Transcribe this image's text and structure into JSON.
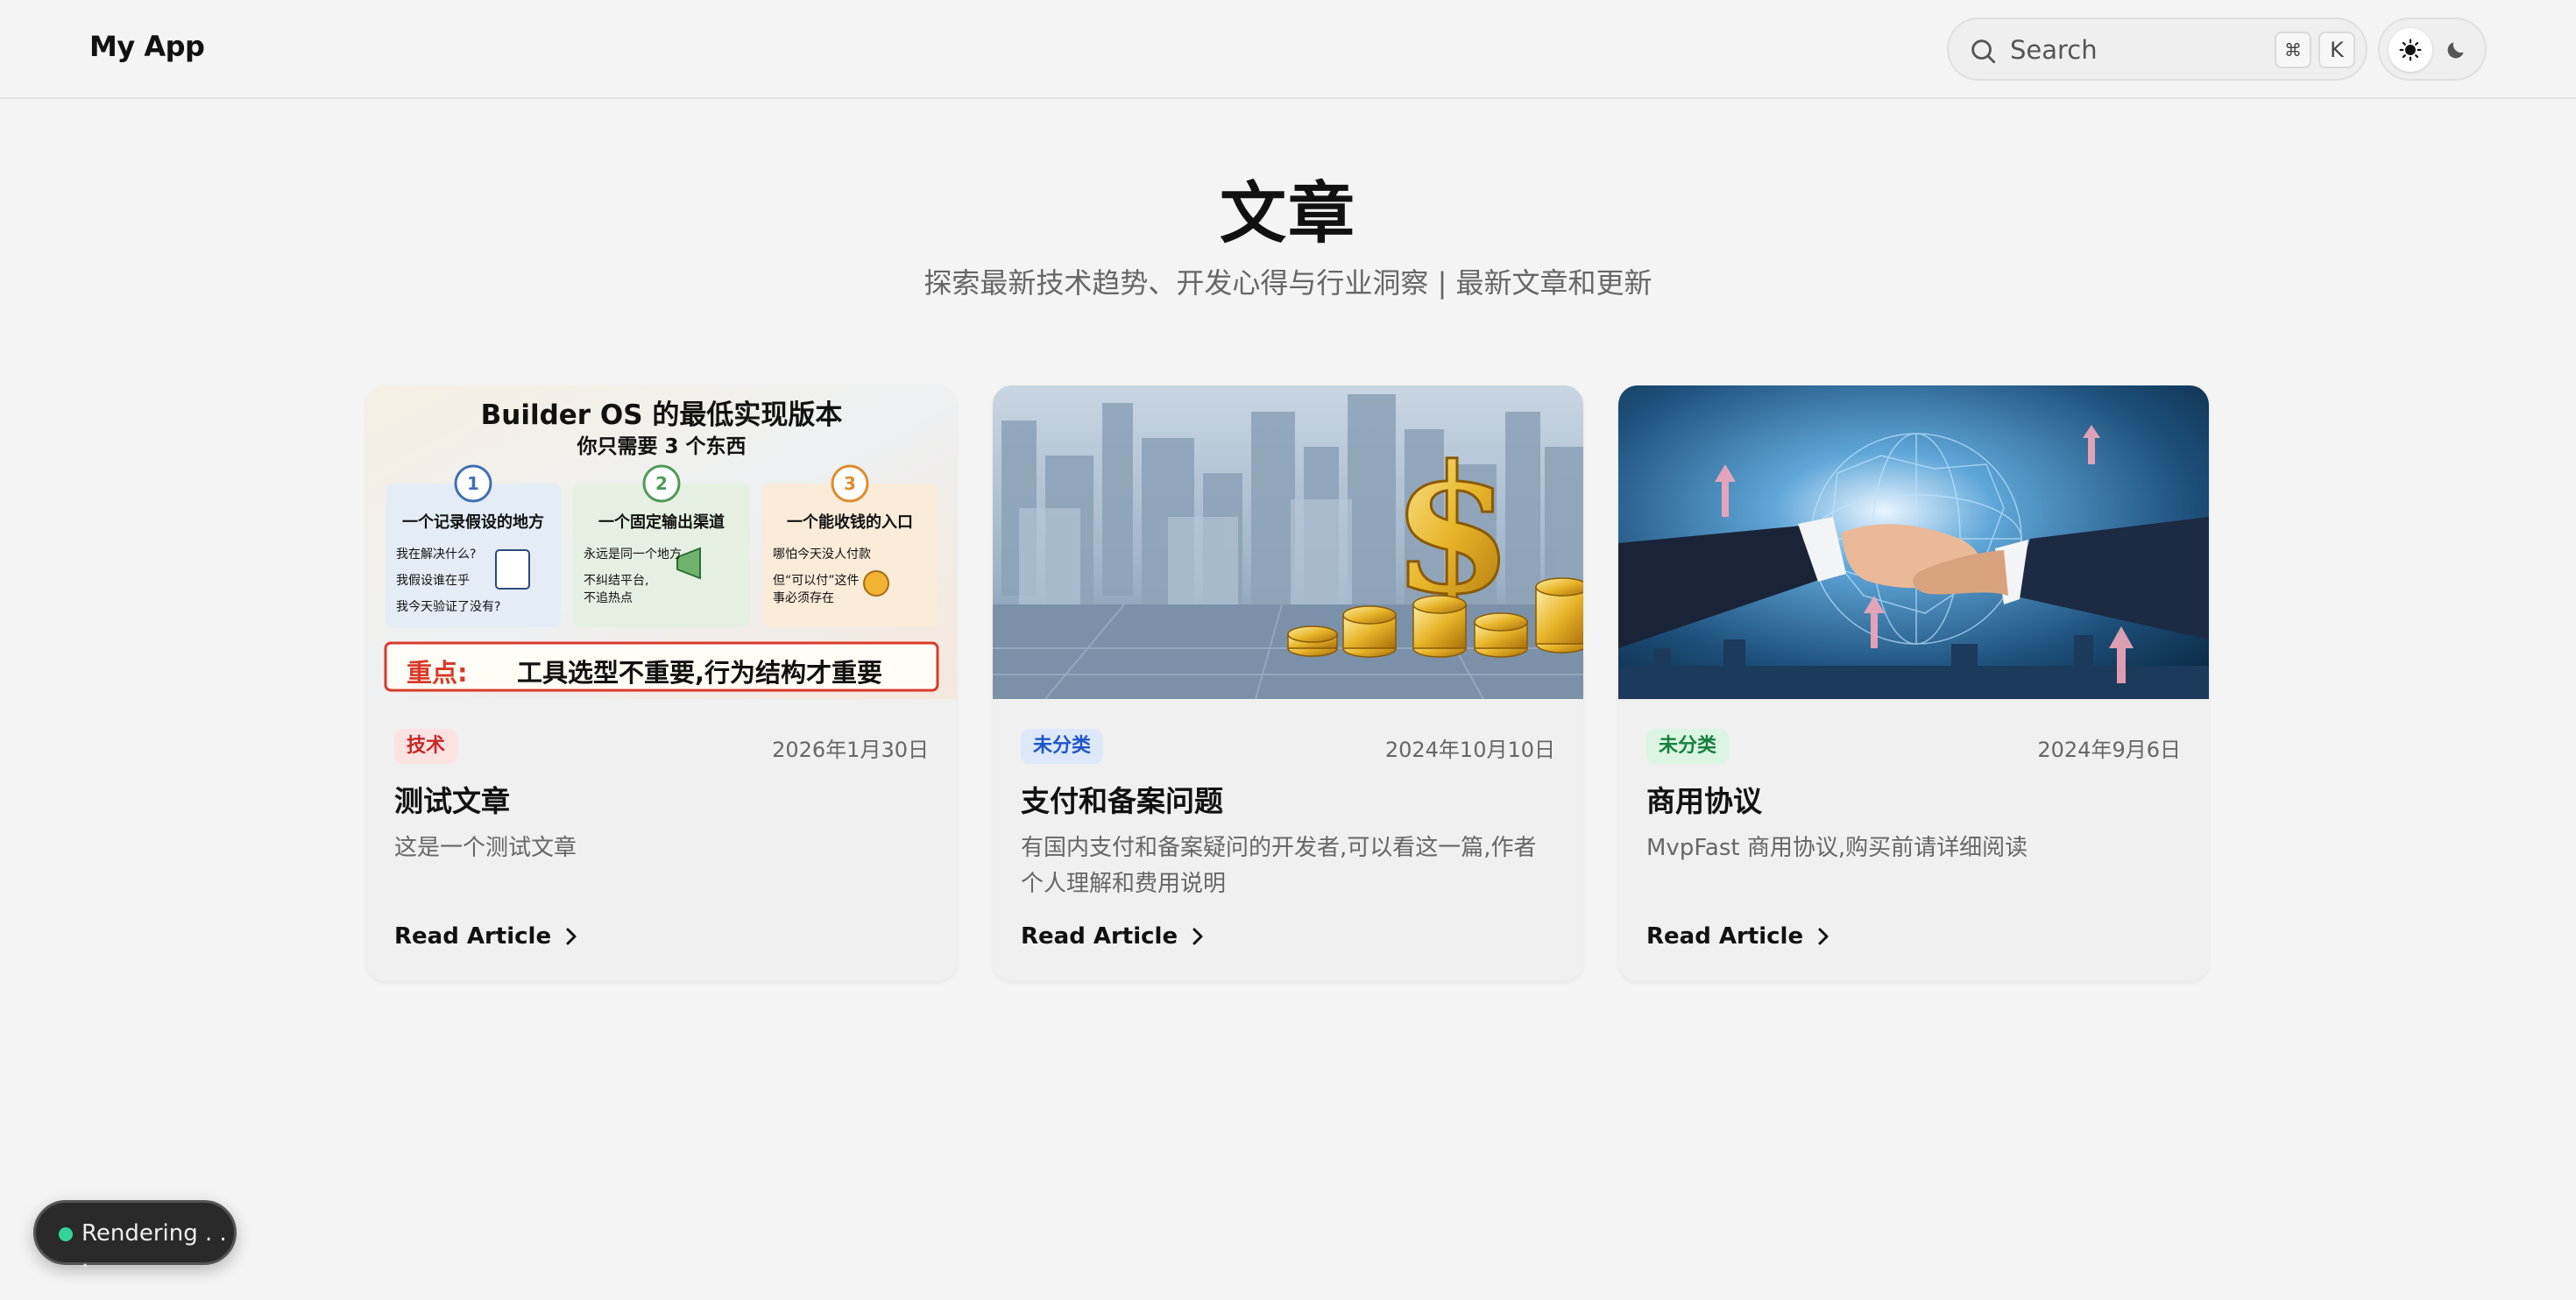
{
  "header": {
    "brand": "My App",
    "search_placeholder": "Search",
    "shortcut_cmd": "⌘",
    "shortcut_key": "K"
  },
  "hero": {
    "title": "文章",
    "subtitle": "探索最新技术趋势、开发心得与行业洞察 | 最新文章和更新"
  },
  "articles": [
    {
      "category": "技术",
      "date": "2026年1月30日",
      "title": "测试文章",
      "excerpt": "这是一个测试文章",
      "read_label": "Read Article",
      "image": {
        "heading": "Builder OS 的最低实现版本",
        "subheading": "你只需要 3 个东西",
        "boxes": [
          {
            "num": "1",
            "title": "一个记录假设的地方",
            "lines": [
              "我在解决什么?",
              "我假设谁在乎",
              "我今天验证了没有?"
            ]
          },
          {
            "num": "2",
            "title": "一个固定输出渠道",
            "lines": [
              "永远是同一个地方",
              "不纠结平台,",
              "不追热点"
            ]
          },
          {
            "num": "3",
            "title": "一个能收钱的入口",
            "lines": [
              "哪怕今天没人付款",
              "但“可以付”这件",
              "事必须存在"
            ]
          }
        ],
        "banner_key": "重点:",
        "banner_text": "工具选型不重要,行为结构才重要"
      }
    },
    {
      "category": "未分类",
      "date": "2024年10月10日",
      "title": "支付和备案问题",
      "excerpt": "有国内支付和备案疑问的开发者,可以看这一篇,作者个人理解和费用说明",
      "read_label": "Read Article"
    },
    {
      "category": "未分类",
      "date": "2024年9月6日",
      "title": "商用协议",
      "excerpt": "MvpFast 商用协议,购买前请详细阅读",
      "read_label": "Read Article"
    }
  ],
  "status": {
    "text": "Rendering . . ."
  },
  "colors": {
    "background": "#f4f4f4",
    "badge_tech": "#c62828",
    "badge_uncategorized_blue": "#1f55c6",
    "badge_uncategorized_green": "#15803d",
    "status_dot": "#34d399"
  }
}
